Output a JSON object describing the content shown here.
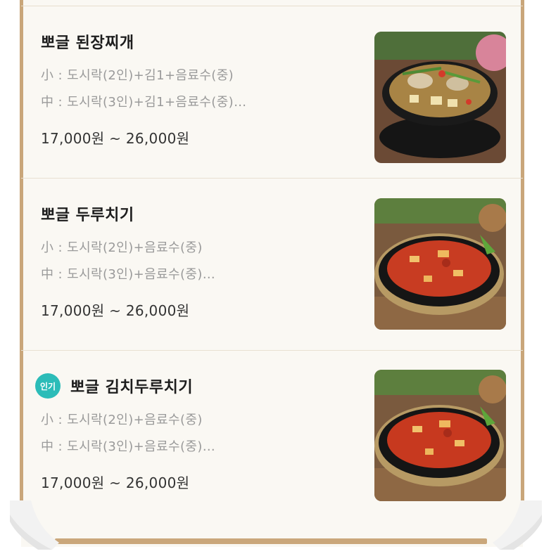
{
  "menu": {
    "items": [
      {
        "name": "뽀글 된장찌개",
        "line1": "小 : 도시락(2인)+김1+음료수(중)",
        "line2": "中 : 도시락(3인)+김1+음료수(중)…",
        "price": "17,000원 ~ 26,000원",
        "popular": false,
        "image_icon": "stew-photo-icon"
      },
      {
        "name": "뽀글 두루치기",
        "line1": "小 : 도시락(2인)+음료수(중)",
        "line2": "中 : 도시락(3인)+음료수(중)…",
        "price": "17,000원 ~ 26,000원",
        "popular": false,
        "image_icon": "stirfry-photo-icon"
      },
      {
        "name": "뽀글 김치두루치기",
        "line1": "小 : 도시락(2인)+음료수(중)",
        "line2": "中 : 도시락(3인)+음료수(중)…",
        "price": "17,000원 ~ 26,000원",
        "popular": true,
        "badge": "인기",
        "image_icon": "kimchi-stirfry-photo-icon"
      }
    ]
  },
  "colors": {
    "frame": "#c9a67a",
    "badge": "#2cbcb8",
    "background": "#faf8f3"
  }
}
